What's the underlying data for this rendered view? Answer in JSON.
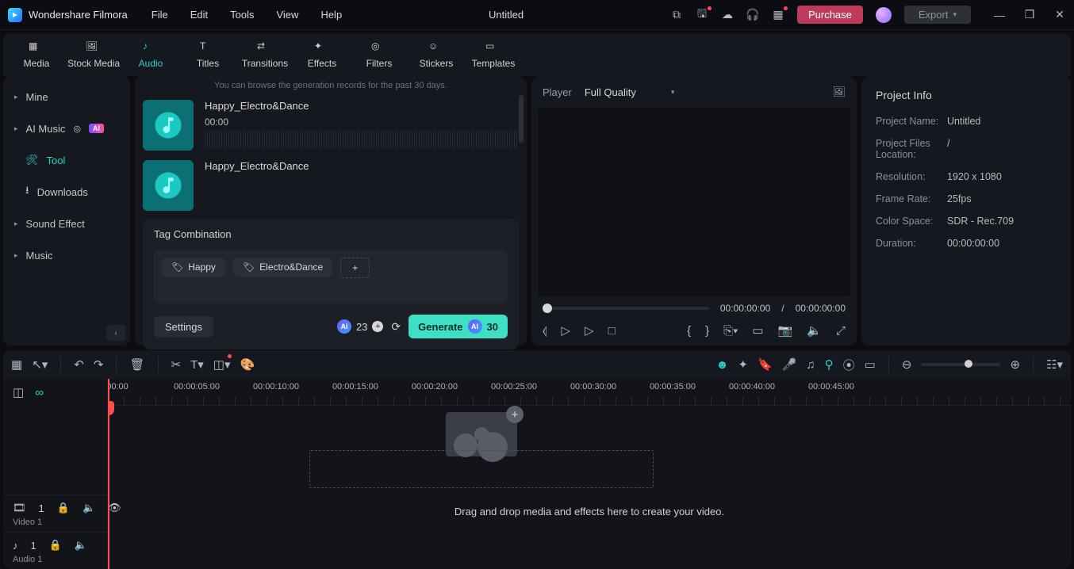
{
  "app": {
    "name": "Wondershare Filmora",
    "doc": "Untitled"
  },
  "menu": [
    "File",
    "Edit",
    "Tools",
    "View",
    "Help"
  ],
  "titlebar": {
    "purchase": "Purchase",
    "export": "Export"
  },
  "tabs": [
    {
      "id": "media",
      "label": "Media"
    },
    {
      "id": "stock",
      "label": "Stock Media"
    },
    {
      "id": "audio",
      "label": "Audio"
    },
    {
      "id": "titles",
      "label": "Titles"
    },
    {
      "id": "transitions",
      "label": "Transitions"
    },
    {
      "id": "effects",
      "label": "Effects"
    },
    {
      "id": "filters",
      "label": "Filters"
    },
    {
      "id": "stickers",
      "label": "Stickers"
    },
    {
      "id": "templates",
      "label": "Templates"
    }
  ],
  "activeTab": "audio",
  "leftnav": {
    "items": [
      {
        "label": "Mine",
        "caret": true
      },
      {
        "label": "AI Music",
        "caret": true,
        "ai": true,
        "badge": "AI"
      },
      {
        "label": "Tool",
        "sub": true,
        "active": true,
        "icon": "tool"
      },
      {
        "label": "Downloads",
        "sub": true,
        "icon": "download"
      },
      {
        "label": "Sound Effect",
        "caret": true
      },
      {
        "label": "Music",
        "caret": true
      }
    ]
  },
  "audio": {
    "hint": "You can browse the generation records for the past 30 days.",
    "tracks": [
      {
        "name": "Happy_Electro&Dance",
        "time": "00:00"
      },
      {
        "name": "Happy_Electro&Dance",
        "time": ""
      }
    ],
    "tagTitle": "Tag Combination",
    "tags": [
      "Happy",
      "Electro&Dance"
    ],
    "settings": "Settings",
    "credits": "23",
    "generate": {
      "label": "Generate",
      "cost": "30"
    }
  },
  "player": {
    "label": "Player",
    "quality": "Full Quality",
    "current": "00:00:00:00",
    "sep": "/",
    "total": "00:00:00:00"
  },
  "info": {
    "title": "Project Info",
    "rows": [
      {
        "k": "Project Name:",
        "v": "Untitled"
      },
      {
        "k": "Project Files Location:",
        "v": "/"
      },
      {
        "k": "Resolution:",
        "v": "1920 x 1080"
      },
      {
        "k": "Frame Rate:",
        "v": "25fps"
      },
      {
        "k": "Color Space:",
        "v": "SDR - Rec.709"
      },
      {
        "k": "Duration:",
        "v": "00:00:00:00"
      }
    ]
  },
  "timeline": {
    "marks": [
      "00:00",
      "00:00:05:00",
      "00:00:10:00",
      "00:00:15:00",
      "00:00:20:00",
      "00:00:25:00",
      "00:00:30:00",
      "00:00:35:00",
      "00:00:40:00",
      "00:00:45:00"
    ],
    "tracks": [
      {
        "id": "video1",
        "label": "Video 1",
        "num": "1"
      },
      {
        "id": "audio1",
        "label": "Audio 1",
        "num": "1"
      }
    ],
    "dropText": "Drag and drop media and effects here to create your video."
  }
}
